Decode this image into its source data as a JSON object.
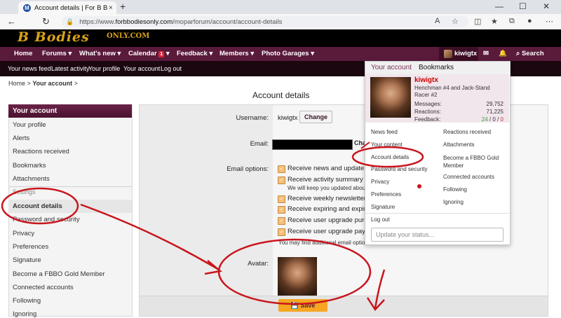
{
  "browser": {
    "tab_title": "Account details | For B Bodies Only",
    "tab_close": "×",
    "new_tab": "+",
    "url_prefix": "https://www.",
    "url_domain": "forbbodiesonly.com",
    "url_path": "/moparforum/account/account-details",
    "win_min": "—",
    "win_max": "☐",
    "win_close": "✕",
    "icon_back": "←",
    "icon_reload": "↻",
    "icon_lock": "🔒"
  },
  "site": {
    "logo_main": "B Bodies",
    "logo_sub": "ONLY.COM"
  },
  "mainnav": {
    "home": "Home",
    "forums": "Forums ▾",
    "whats_new": "What's new ▾",
    "calendar": "Calendar",
    "calendar_badge": "1",
    "feedback": "Feedback ▾",
    "members": "Members ▾",
    "photo_garages": "Photo Garages ▾",
    "username": "kiwigtx",
    "search": "Search"
  },
  "subnav": [
    "Your news feed",
    "Latest activity",
    "Your profile",
    "Your account",
    "Log out"
  ],
  "breadcrumb": {
    "home": "Home",
    "sep": ">",
    "current": "Your account",
    "sep2": ">"
  },
  "page_title": "Account details",
  "sidebar": {
    "header": "Your account",
    "items": [
      "Your profile",
      "Alerts",
      "Reactions received",
      "Bookmarks",
      "Attachments"
    ],
    "settings_label": "Settings",
    "settings_items": [
      "Account details",
      "Password and security",
      "Privacy",
      "Preferences",
      "Signature",
      "Become a FBBO Gold Member",
      "Connected accounts",
      "Following",
      "Ignoring"
    ]
  },
  "form": {
    "username_label": "Username:",
    "username_value": "kiwigtx",
    "change_btn": "Change",
    "email_label": "Email:",
    "email_change": "Cha",
    "email_options_label": "Email options:",
    "options": [
      "Receive news and update em",
      "Receive activity summary em",
      "Receive weekly newsletter e",
      "Receive expiring and expired",
      "Receive user upgrade purcha",
      "Receive user upgrade payme"
    ],
    "activity_note": "We will keep you updated about",
    "footer_note": "You may find additional email option",
    "avatar_label": "Avatar:",
    "save_btn": "Save"
  },
  "dropdown": {
    "tab_account": "Your account",
    "tab_bookmarks": "Bookmarks",
    "name": "kiwigtx",
    "user_title": "Henchman #4 and Jack-Stand Racer #2",
    "messages_label": "Messages:",
    "messages_value": "29,752",
    "reactions_label": "Reactions:",
    "reactions_value": "71,225",
    "feedback_label": "Feedback:",
    "feedback_pos": "24",
    "feedback_neu": "0",
    "feedback_neg": "0",
    "feedback_sep": "/",
    "left_links": [
      "News feed",
      "Your content",
      "Account details",
      "Password and security",
      "Privacy",
      "Preferences",
      "Signature"
    ],
    "right_links": [
      "Reactions received",
      "Attachments",
      "Become a FBBO Gold Member",
      "Connected accounts",
      "Following",
      "Ignoring"
    ],
    "logout": "Log out",
    "status_placeholder": "Update your status..."
  },
  "colors": {
    "nav_maroon": "#5a1b3b",
    "accent": "#7a2e55",
    "save_orange": "#f6a620",
    "annotation_red": "#c8161d"
  }
}
